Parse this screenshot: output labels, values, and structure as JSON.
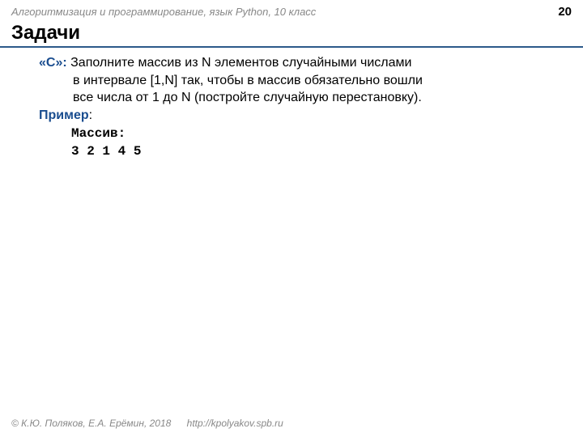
{
  "header": {
    "course": "Алгоритмизация и программирование, язык Python, 10 класс",
    "page_number": "20"
  },
  "title": "Задачи",
  "task": {
    "label": "«C»:",
    "text_line1": "Заполните массив из N элементов случайными числами",
    "text_line2": "в интервале [1,N] так, чтобы в массив обязательно вошли",
    "text_line3": "все числа от 1 до N (постройте случайную перестановку)."
  },
  "example": {
    "label": "Пример",
    "colon": ":",
    "code_line1": "Массив:",
    "code_line2": "3 2 1 4 5"
  },
  "footer": {
    "copyright": "© К.Ю. Поляков, Е.А. Ерёмин, 2018",
    "url": "http://kpolyakov.spb.ru"
  }
}
